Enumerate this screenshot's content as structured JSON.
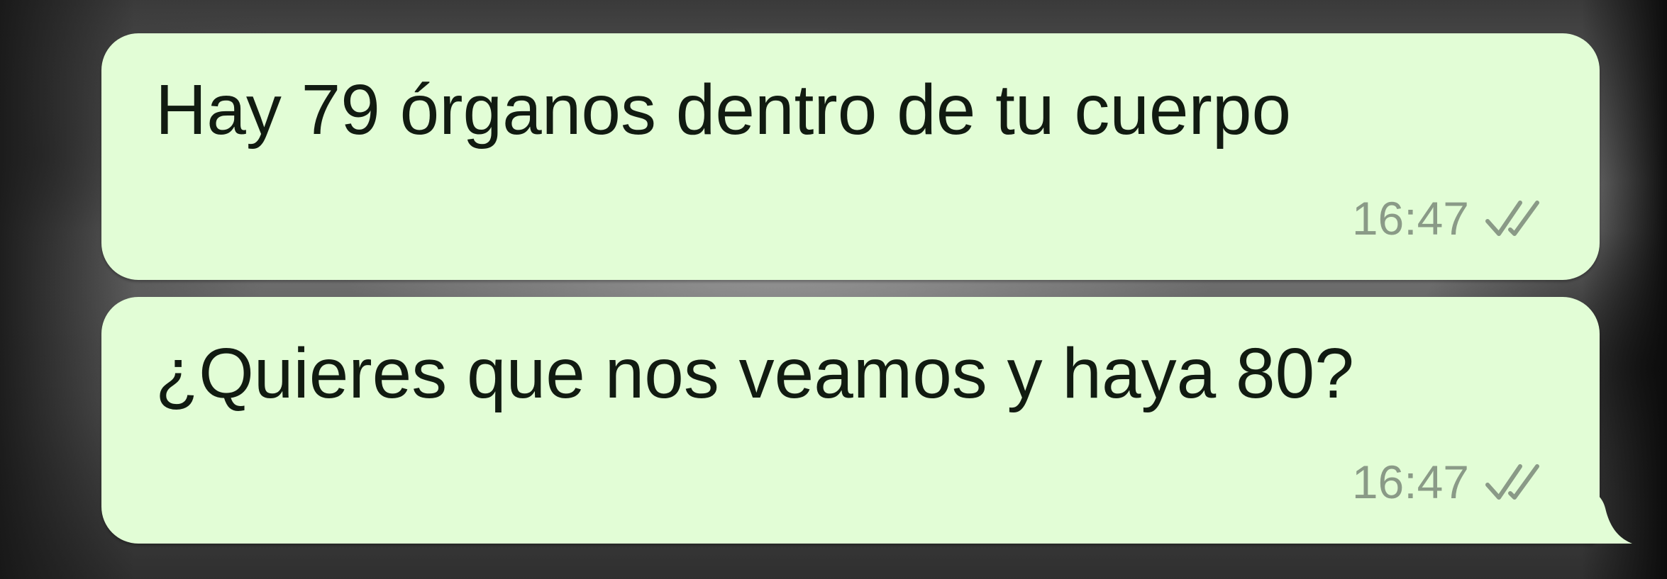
{
  "chat": {
    "messages": [
      {
        "text": "Hay 79 órganos dentro de tu cuerpo",
        "time": "16:47",
        "status_icon": "double-check-icon"
      },
      {
        "text": "¿Quieres que nos veamos y haya 80?",
        "time": "16:47",
        "status_icon": "double-check-icon"
      }
    ]
  },
  "colors": {
    "bubble": "#e2fdd6",
    "text": "#111b11",
    "time": "#8a9a87"
  }
}
